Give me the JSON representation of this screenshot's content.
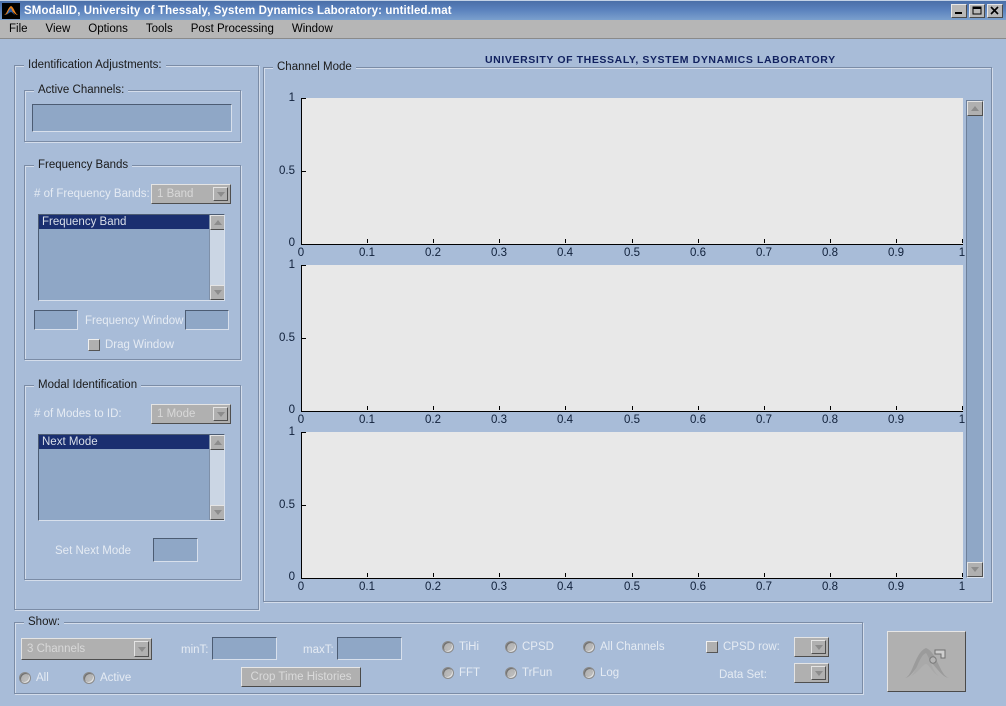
{
  "window": {
    "title": "SModalID, University of Thessaly, System Dynamics Laboratory: untitled.mat",
    "app_icon": "matlab-membrane-icon",
    "minimize_label": "_",
    "maximize_label": "□",
    "close_label": "✕"
  },
  "menubar": {
    "items": [
      {
        "label": "File"
      },
      {
        "label": "View"
      },
      {
        "label": "Options"
      },
      {
        "label": "Tools"
      },
      {
        "label": "Post Processing"
      },
      {
        "label": "Window"
      }
    ]
  },
  "left_panel": {
    "title": "Identification Adjustments:",
    "active_channels": {
      "title": "Active Channels:",
      "value": ""
    },
    "frequency_bands": {
      "title": "Frequency Bands",
      "count_label": "# of Frequency Bands:",
      "count_value": "1 Band",
      "count_options": [
        "1 Band"
      ],
      "list_items": [
        "Frequency Band"
      ],
      "selected_index": 0,
      "window_label": "Frequency Window",
      "window_min_value": "",
      "window_max_value": "",
      "drag_window_label": "Drag Window",
      "drag_window_checked": false
    },
    "modal_identification": {
      "title": "Modal Identification",
      "count_label": "# of Modes to ID:",
      "count_value": "1 Mode",
      "count_options": [
        "1 Mode"
      ],
      "list_items": [
        "Next Mode"
      ],
      "selected_index": 0,
      "set_next_mode_label": "Set Next Mode",
      "set_next_mode_value": ""
    }
  },
  "plot_panel": {
    "title": "Channel Mode",
    "banner": "UNIVERSITY OF THESSALY, SYSTEM DYNAMICS LABORATORY",
    "scrollbar": {
      "up_arrow": "▲",
      "down_arrow": "▼"
    }
  },
  "chart_data": [
    {
      "type": "line",
      "title": "",
      "xlabel": "",
      "ylabel": "",
      "x": [],
      "values": [],
      "series": [],
      "xlim": [
        0,
        1
      ],
      "ylim": [
        0,
        1
      ],
      "xticks": [
        0,
        0.1,
        0.2,
        0.3,
        0.4,
        0.5,
        0.6,
        0.7,
        0.8,
        0.9,
        1
      ],
      "xticklabels": [
        "0",
        "0.1",
        "0.2",
        "0.3",
        "0.4",
        "0.5",
        "0.6",
        "0.7",
        "0.8",
        "0.9",
        "1"
      ],
      "yticks": [
        0,
        0.5,
        1
      ],
      "yticklabels": [
        "0",
        "0.5",
        "1"
      ],
      "grid": false,
      "legend": null
    },
    {
      "type": "line",
      "title": "",
      "xlabel": "",
      "ylabel": "",
      "x": [],
      "values": [],
      "series": [],
      "xlim": [
        0,
        1
      ],
      "ylim": [
        0,
        1
      ],
      "xticks": [
        0,
        0.1,
        0.2,
        0.3,
        0.4,
        0.5,
        0.6,
        0.7,
        0.8,
        0.9,
        1
      ],
      "xticklabels": [
        "0",
        "0.1",
        "0.2",
        "0.3",
        "0.4",
        "0.5",
        "0.6",
        "0.7",
        "0.8",
        "0.9",
        "1"
      ],
      "yticks": [
        0,
        0.5,
        1
      ],
      "yticklabels": [
        "0",
        "0.5",
        "1"
      ],
      "grid": false,
      "legend": null
    },
    {
      "type": "line",
      "title": "",
      "xlabel": "",
      "ylabel": "",
      "x": [],
      "values": [],
      "series": [],
      "xlim": [
        0,
        1
      ],
      "ylim": [
        0,
        1
      ],
      "xticks": [
        0,
        0.1,
        0.2,
        0.3,
        0.4,
        0.5,
        0.6,
        0.7,
        0.8,
        0.9,
        1
      ],
      "xticklabels": [
        "0",
        "0.1",
        "0.2",
        "0.3",
        "0.4",
        "0.5",
        "0.6",
        "0.7",
        "0.8",
        "0.9",
        "1"
      ],
      "yticks": [
        0,
        0.5,
        1
      ],
      "yticklabels": [
        "0",
        "0.5",
        "1"
      ],
      "grid": false,
      "legend": null
    }
  ],
  "bottom_panel": {
    "title": "Show:",
    "channels_value": "3 Channels",
    "channels_options": [
      "3 Channels"
    ],
    "all_label": "All",
    "all_checked": false,
    "active_label": "Active",
    "active_checked": false,
    "mint_label": "minT:",
    "mint_value": "",
    "maxt_label": "maxT:",
    "maxt_value": "",
    "crop_button_label": "Crop Time Histories",
    "tihi_label": "TiHi",
    "tihi_checked": false,
    "fft_label": "FFT",
    "fft_checked": false,
    "cpsd_label": "CPSD",
    "cpsd_checked": false,
    "trfun_label": "TrFun",
    "trfun_checked": false,
    "all_channels_label": "All Channels",
    "all_channels_checked": false,
    "log_label": "Log",
    "log_checked": false,
    "cpsd_row_label": "CPSD row:",
    "cpsd_row_checked": false,
    "cpsd_row_value": "",
    "data_set_label": "Data Set:",
    "data_set_value": "",
    "logo_button": "membrane-logo-button"
  },
  "colors": {
    "desktop": "#a8bcd8",
    "titlebar": "#5a81bd",
    "menubar": "#b6b6b6",
    "axes_bg": "#e8e8e8",
    "selection": "#1a2f70",
    "banner_text": "#10205e"
  }
}
